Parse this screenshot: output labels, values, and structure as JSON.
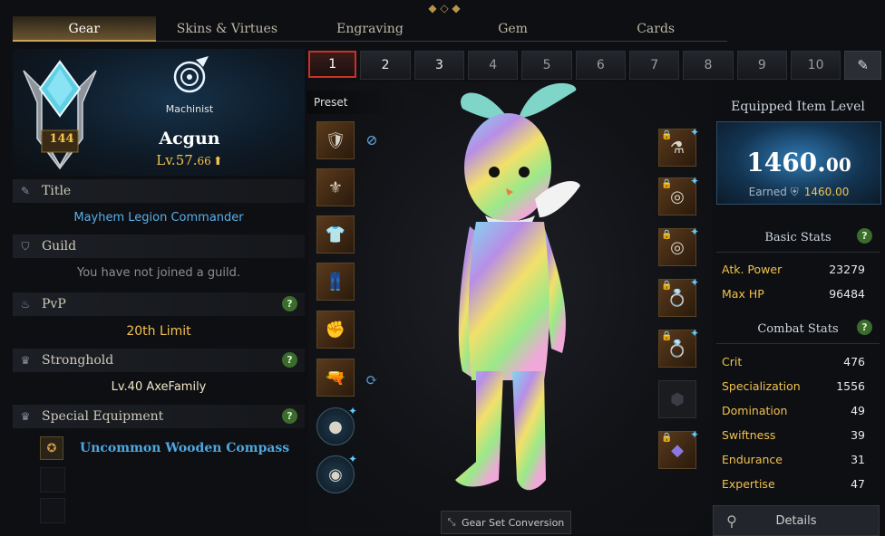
{
  "tabs": [
    "Gear",
    "Skins & Virtues",
    "Engraving",
    "Gem",
    "Cards"
  ],
  "profile": {
    "rank": "144",
    "class_name": "Machinist",
    "name": "Acgun",
    "level_main": "Lv.57.",
    "level_frac": "66"
  },
  "sections": {
    "title": {
      "label": "Title",
      "value": "Mayhem Legion Commander"
    },
    "guild": {
      "label": "Guild",
      "value": "You have not joined a guild."
    },
    "pvp": {
      "label": "PvP",
      "value": "20th Limit"
    },
    "stronghold": {
      "label": "Stronghold",
      "value": "Lv.40 AxeFamily"
    },
    "special": {
      "label": "Special Equipment",
      "item": "Uncommon Wooden Compass"
    }
  },
  "presets": [
    "1",
    "2",
    "3",
    "4",
    "5",
    "6",
    "7",
    "8",
    "9",
    "10"
  ],
  "preset_label": "Preset",
  "gear_set_conversion": "Gear Set Conversion",
  "equipped": {
    "title": "Equipped Item Level",
    "value_main": "1460.",
    "value_frac": "00",
    "earned_label": "Earned",
    "earned_value": "1460.00"
  },
  "basic_stats": {
    "title": "Basic Stats",
    "rows": [
      {
        "k": "Atk. Power",
        "v": "23279"
      },
      {
        "k": "Max HP",
        "v": "96484"
      }
    ]
  },
  "combat_stats": {
    "title": "Combat Stats",
    "rows": [
      {
        "k": "Crit",
        "v": "476"
      },
      {
        "k": "Specialization",
        "v": "1556"
      },
      {
        "k": "Domination",
        "v": "49"
      },
      {
        "k": "Swiftness",
        "v": "39"
      },
      {
        "k": "Endurance",
        "v": "31"
      },
      {
        "k": "Expertise",
        "v": "47"
      }
    ]
  },
  "details_label": "Details",
  "colors": {
    "accent_gold": "#f2c14e",
    "link_blue": "#4fa7e0",
    "preset_selected": "#c63228"
  }
}
